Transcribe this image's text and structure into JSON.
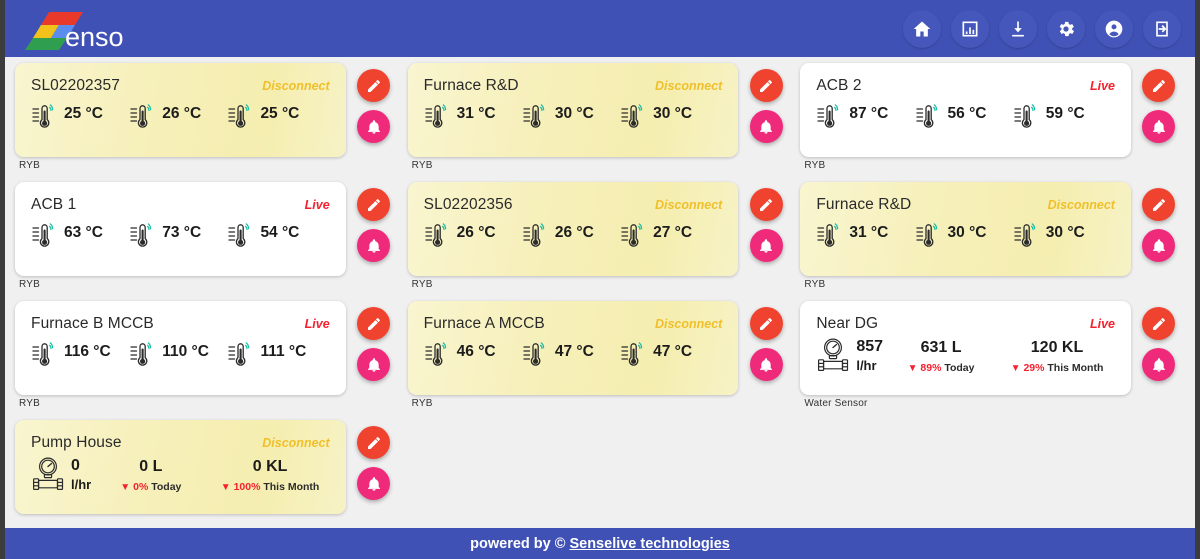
{
  "header": {
    "brand_text": "enso",
    "brand_colors": {
      "red": "#e8392a",
      "yellow": "#f2c21a",
      "blue": "#5b8def",
      "green": "#2f9e4f"
    },
    "bar_color": "#3f51b5",
    "icons": [
      {
        "name": "home-icon",
        "label": "Home"
      },
      {
        "name": "analytics-icon",
        "label": "Reports"
      },
      {
        "name": "download-icon",
        "label": "Download"
      },
      {
        "name": "gear-icon",
        "label": "Settings"
      },
      {
        "name": "account-icon",
        "label": "Account"
      },
      {
        "name": "logout-icon",
        "label": "Logout"
      }
    ]
  },
  "colors": {
    "live": "#f4212e",
    "disconnect": "#f0c02b",
    "edit_button": "#f0432f",
    "alert_button": "#f02a7a"
  },
  "status_labels": {
    "live": "Live",
    "disconnect": "Disconnect"
  },
  "actions": {
    "edit": "Edit",
    "alert": "Alerts"
  },
  "cards": [
    {
      "type": "temperature",
      "title": "SL02202357",
      "status": "Disconnect",
      "status_kind": "disc",
      "readings": [
        "25 °C",
        "26 °C",
        "25 °C"
      ],
      "sublabel": "RYB"
    },
    {
      "type": "temperature",
      "title": "Furnace R&D",
      "status": "Disconnect",
      "status_kind": "disc",
      "readings": [
        "31 °C",
        "30 °C",
        "30 °C"
      ],
      "sublabel": "RYB"
    },
    {
      "type": "temperature",
      "title": "ACB 2",
      "status": "Live",
      "status_kind": "live",
      "readings": [
        "87 °C",
        "56 °C",
        "59 °C"
      ],
      "sublabel": "RYB"
    },
    {
      "type": "temperature",
      "title": "ACB 1",
      "status": "Live",
      "status_kind": "live",
      "readings": [
        "63 °C",
        "73 °C",
        "54 °C"
      ],
      "sublabel": "RYB"
    },
    {
      "type": "temperature",
      "title": "SL02202356",
      "status": "Disconnect",
      "status_kind": "disc",
      "readings": [
        "26 °C",
        "26 °C",
        "27 °C"
      ],
      "sublabel": "RYB"
    },
    {
      "type": "temperature",
      "title": "Furnace R&D",
      "status": "Disconnect",
      "status_kind": "disc",
      "readings": [
        "31 °C",
        "30 °C",
        "30 °C"
      ],
      "sublabel": "RYB"
    },
    {
      "type": "temperature",
      "title": "Furnace B MCCB",
      "status": "Live",
      "status_kind": "live",
      "readings": [
        "116 °C",
        "110 °C",
        "111 °C"
      ],
      "sublabel": "RYB"
    },
    {
      "type": "temperature",
      "title": "Furnace A MCCB",
      "status": "Disconnect",
      "status_kind": "disc",
      "readings": [
        "46 °C",
        "47 °C",
        "47 °C"
      ],
      "sublabel": "RYB"
    },
    {
      "type": "water",
      "title": "Near DG",
      "status": "Live",
      "status_kind": "live",
      "flow_value": "857",
      "flow_unit": "l/hr",
      "today_value": "631 L",
      "today_pct": "89%",
      "today_label": "Today",
      "month_value": "120 KL",
      "month_pct": "29%",
      "month_label": "This Month",
      "sublabel": "Water Sensor"
    },
    {
      "type": "water",
      "title": "Pump House",
      "status": "Disconnect",
      "status_kind": "disc",
      "flow_value": "0",
      "flow_unit": "l/hr",
      "today_value": "0 L",
      "today_pct": "0%",
      "today_label": "Today",
      "month_value": "0 KL",
      "month_pct": "100%",
      "month_label": "This Month",
      "sublabel": ""
    }
  ],
  "footer": {
    "prefix": "powered by © ",
    "link": "Senselive technologies"
  }
}
